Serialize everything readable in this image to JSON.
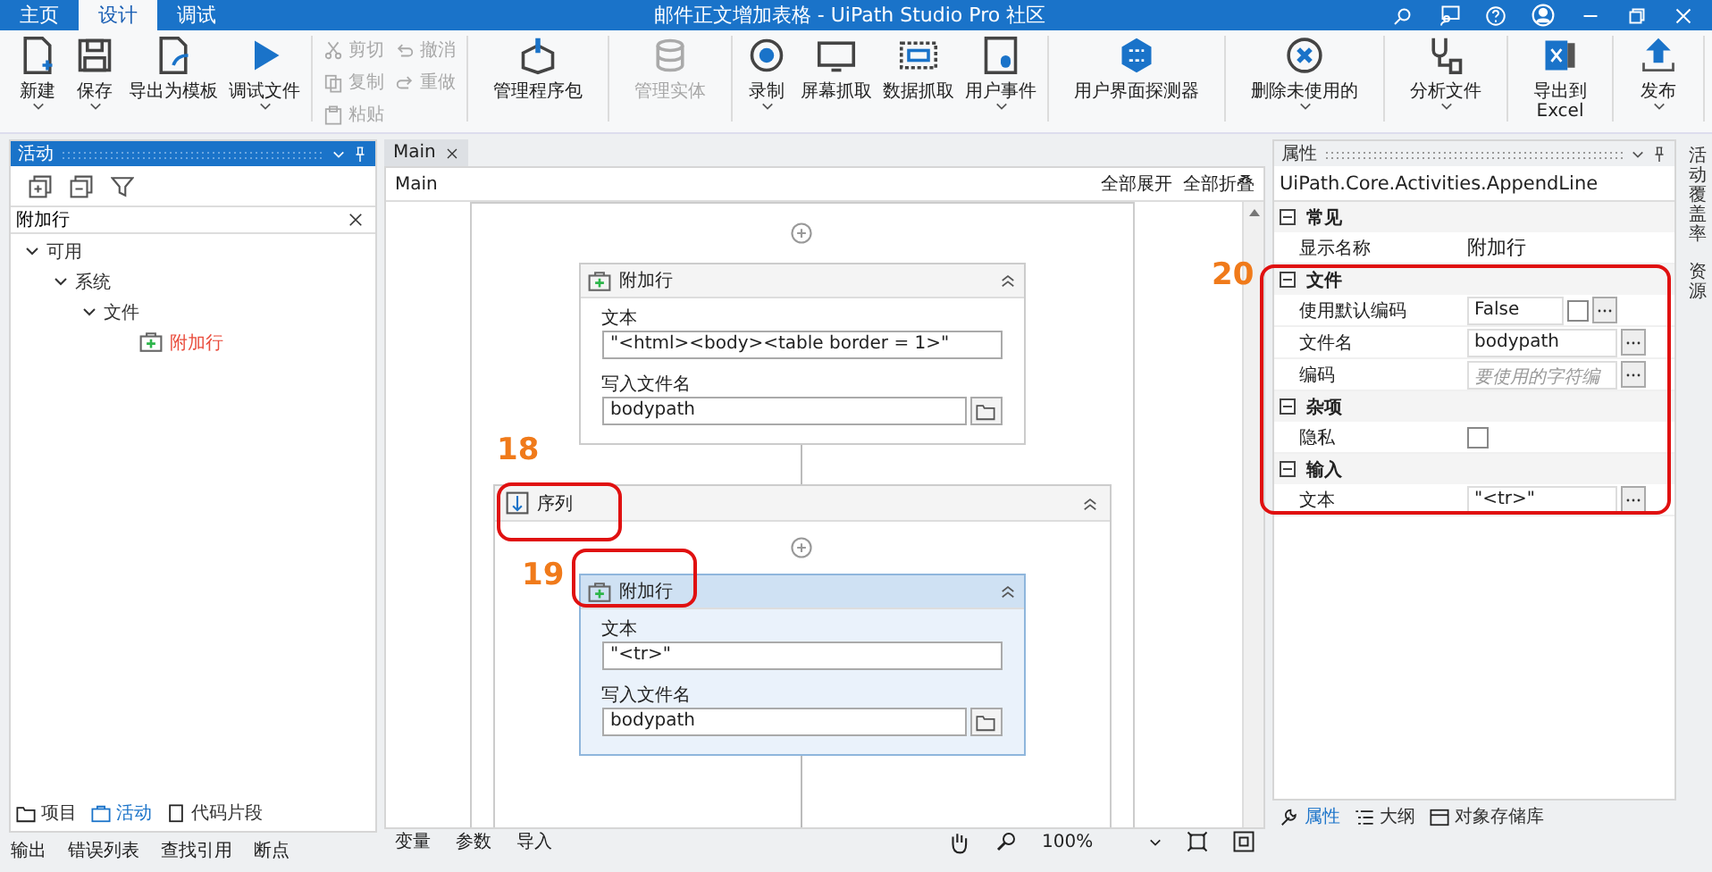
{
  "window": {
    "title": "邮件正文增加表格 - UiPath Studio Pro 社区"
  },
  "menu_tabs": [
    {
      "label": "主页",
      "selected": false
    },
    {
      "label": "设计",
      "selected": true
    },
    {
      "label": "调试",
      "selected": false
    }
  ],
  "ribbon": [
    {
      "kind": "large",
      "items": [
        {
          "label": "新建",
          "has_menu": true,
          "disabled": false
        },
        {
          "label": "保存",
          "has_menu": true,
          "disabled": false
        },
        {
          "label": "导出为模板",
          "has_menu": false,
          "disabled": false
        },
        {
          "label": "调试文件",
          "has_menu": true,
          "disabled": false
        }
      ]
    },
    {
      "kind": "small",
      "items": [
        {
          "label": "剪切",
          "disabled": true
        },
        {
          "label": "复制",
          "disabled": true
        },
        {
          "label": "粘贴",
          "disabled": true
        },
        {
          "label": "撤消",
          "disabled": true
        },
        {
          "label": "重做",
          "disabled": true
        }
      ]
    },
    {
      "kind": "large",
      "items": [
        {
          "label": "管理程序包",
          "has_menu": false,
          "disabled": false
        }
      ]
    },
    {
      "kind": "large",
      "items": [
        {
          "label": "管理实体",
          "has_menu": false,
          "disabled": true
        }
      ]
    },
    {
      "kind": "large",
      "items": [
        {
          "label": "录制",
          "has_menu": true,
          "disabled": false
        },
        {
          "label": "屏幕抓取",
          "has_menu": false,
          "disabled": false
        },
        {
          "label": "数据抓取",
          "has_menu": false,
          "disabled": false
        },
        {
          "label": "用户事件",
          "has_menu": true,
          "disabled": false
        }
      ]
    },
    {
      "kind": "large",
      "items": [
        {
          "label": "用户界面探测器",
          "has_menu": false,
          "disabled": false
        }
      ]
    },
    {
      "kind": "large",
      "items": [
        {
          "label": "删除未使用的",
          "has_menu": true,
          "disabled": false
        }
      ]
    },
    {
      "kind": "large",
      "items": [
        {
          "label": "分析文件",
          "has_menu": true,
          "disabled": false
        }
      ]
    },
    {
      "kind": "large",
      "items": [
        {
          "label": "导出到\nExcel",
          "has_menu": false,
          "disabled": false
        }
      ]
    },
    {
      "kind": "large",
      "items": [
        {
          "label": "发布",
          "has_menu": true,
          "disabled": false
        }
      ]
    }
  ],
  "activities_panel": {
    "title": "活动",
    "search": "附加行",
    "tree": [
      {
        "label": "可用",
        "expanded": true,
        "children": [
          {
            "label": "系统",
            "expanded": true,
            "children": [
              {
                "label": "文件",
                "expanded": true,
                "children": [
                  {
                    "label": "附加行",
                    "match": true
                  }
                ]
              }
            ]
          }
        ]
      }
    ],
    "tabs": [
      {
        "label": "项目",
        "selected": false
      },
      {
        "label": "活动",
        "selected": true
      },
      {
        "label": "代码片段",
        "selected": false
      }
    ]
  },
  "designer": {
    "tab": "Main",
    "breadcrumb": "Main",
    "expand_all": "全部展开",
    "collapse_all": "全部折叠",
    "activities": [
      {
        "title": "附加行",
        "selected": false,
        "fields": [
          {
            "label": "文本",
            "value": "\"<html><body><table border = 1>\"",
            "browse": false
          },
          {
            "label": "写入文件名",
            "value": "bodypath",
            "browse": true
          }
        ]
      }
    ],
    "sequence": {
      "title": "序列",
      "activities": [
        {
          "title": "附加行",
          "selected": true,
          "fields": [
            {
              "label": "文本",
              "value": "\"<tr>\"",
              "browse": false
            },
            {
              "label": "写入文件名",
              "value": "bodypath",
              "browse": true
            }
          ]
        }
      ]
    },
    "bottom_tabs": [
      "变量",
      "参数",
      "导入"
    ],
    "zoom": "100%"
  },
  "properties": {
    "title": "属性",
    "type": "UiPath.Core.Activities.AppendLine",
    "categories": [
      {
        "name": "常见",
        "expanded": true,
        "rows": [
          {
            "kind": "plain",
            "label": "显示名称",
            "value": "附加行"
          }
        ]
      },
      {
        "name": "文件",
        "expanded": true,
        "rows": [
          {
            "kind": "bool",
            "label": "使用默认编码",
            "value": "False",
            "checked": false
          },
          {
            "kind": "field",
            "label": "文件名",
            "value": "bodypath"
          },
          {
            "kind": "field",
            "label": "编码",
            "placeholder": "要使用的字符编"
          }
        ]
      },
      {
        "name": "杂项",
        "expanded": true,
        "rows": [
          {
            "kind": "checkbox",
            "label": "隐私",
            "checked": false
          }
        ]
      },
      {
        "name": "输入",
        "expanded": true,
        "rows": [
          {
            "kind": "field",
            "label": "文本",
            "value": "\"<tr>\""
          }
        ]
      }
    ],
    "tabs": [
      {
        "label": "属性",
        "selected": true
      },
      {
        "label": "大纲",
        "selected": false
      },
      {
        "label": "对象存储库",
        "selected": false
      }
    ]
  },
  "side_tabs": [
    "活动覆盖率",
    "资源"
  ],
  "output_tabs": [
    "输出",
    "错误列表",
    "查找引用",
    "断点"
  ],
  "annotations": [
    {
      "number": "18"
    },
    {
      "number": "19"
    },
    {
      "number": "20"
    }
  ]
}
